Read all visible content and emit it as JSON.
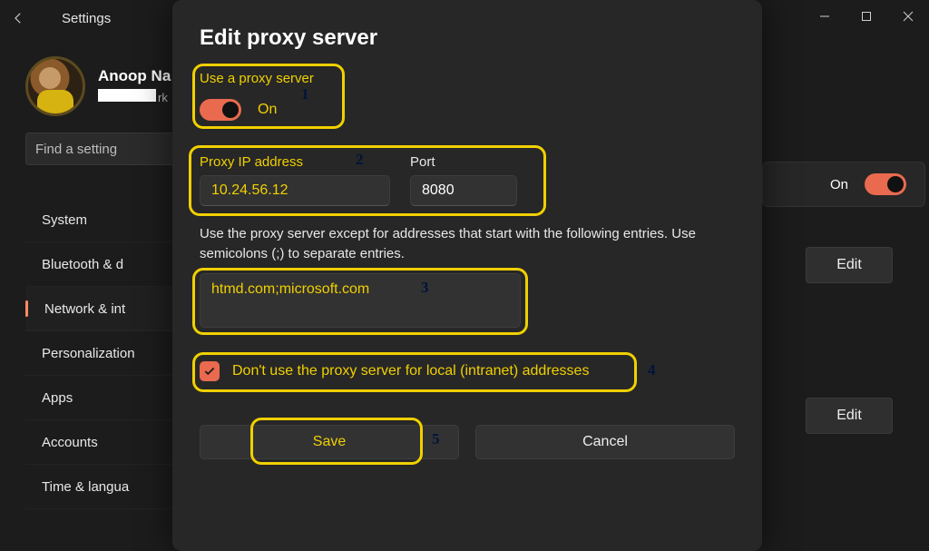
{
  "titlebar": {
    "title": "Settings"
  },
  "profile": {
    "name": "Anoop Na",
    "subTail": "rk"
  },
  "search": {
    "placeholder": "Find a setting"
  },
  "nav": {
    "items": [
      {
        "label": "System"
      },
      {
        "label": "Bluetooth & d"
      },
      {
        "label": "Network & int"
      },
      {
        "label": "Personalization"
      },
      {
        "label": "Apps"
      },
      {
        "label": "Accounts"
      },
      {
        "label": "Time & langua"
      }
    ],
    "activeIndex": 2
  },
  "peek": {
    "on": "On",
    "edit": "Edit"
  },
  "modal": {
    "title": "Edit proxy server",
    "useProxyLabel": "Use a proxy server",
    "toggleState": "On",
    "proxyIpLabel": "Proxy IP address",
    "proxyIpValue": "10.24.56.12",
    "portLabel": "Port",
    "portValue": "8080",
    "exceptDesc": "Use the proxy server except for addresses that start with the following entries. Use semicolons (;) to separate entries.",
    "exceptValue": "htmd.com;microsoft.com",
    "localLabel": "Don't use the proxy server for local (intranet) addresses",
    "saveLabel": "Save",
    "cancelLabel": "Cancel"
  },
  "annotations": {
    "n1": "1",
    "n2": "2",
    "n3": "3",
    "n4": "4",
    "n5": "5"
  }
}
